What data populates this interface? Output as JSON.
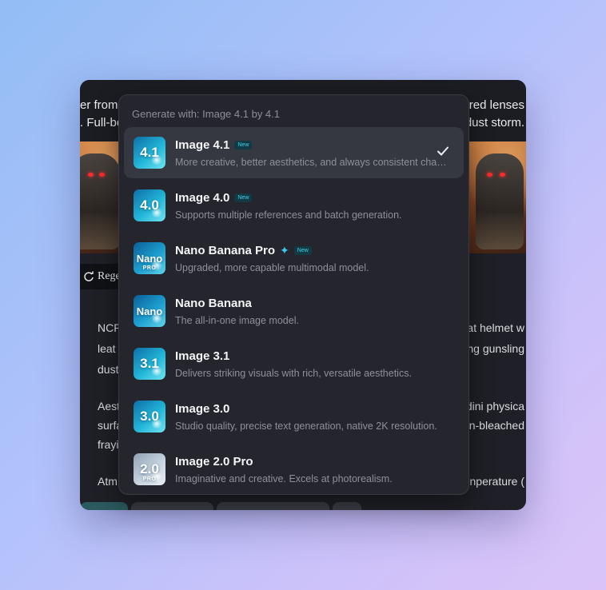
{
  "background_prompt": {
    "top_line_left": "er from",
    "top_line_right": "g red lenses",
    "second_line_left": ". Full-bo",
    "second_line_right": "dust storm.",
    "regen_label": "Regen",
    "lines": [
      {
        "left": "NCR",
        "right": "oat helmet w"
      },
      {
        "left": "leat",
        "right": "ing gunsling"
      },
      {
        "left": "dust",
        "right": ""
      },
      {
        "left": "Aest",
        "right": "dini physica"
      },
      {
        "left": "surfa",
        "right": "n-bleached"
      },
      {
        "left": "frayi",
        "right": ""
      },
      {
        "left": "Atm",
        "right": "nperature ("
      }
    ]
  },
  "dropdown": {
    "header": "Generate with: Image 4.1 by 4.1",
    "models": [
      {
        "name": "Image 4.1",
        "icon_label": "4.1",
        "badge": "New",
        "sparkle": false,
        "selected": true,
        "description": "More creative, better aesthetics, and always consistent characters."
      },
      {
        "name": "Image 4.0",
        "icon_label": "4.0",
        "badge": "New",
        "sparkle": false,
        "selected": false,
        "description": "Supports multiple references and batch generation."
      },
      {
        "name": "Nano Banana Pro",
        "icon_label": "Nano",
        "icon_sub": "PRO",
        "badge": "New",
        "sparkle": true,
        "selected": false,
        "description": "Upgraded, more capable multimodal model."
      },
      {
        "name": "Nano Banana",
        "icon_label": "Nano",
        "badge": "",
        "sparkle": false,
        "selected": false,
        "description": "The all-in-one image model."
      },
      {
        "name": "Image 3.1",
        "icon_label": "3.1",
        "badge": "",
        "sparkle": false,
        "selected": false,
        "description": "Delivers striking visuals with rich, versatile aesthetics."
      },
      {
        "name": "Image 3.0",
        "icon_label": "3.0",
        "badge": "",
        "sparkle": false,
        "selected": false,
        "description": "Studio quality, precise text generation, native 2K resolution."
      },
      {
        "name": "Image 2.0 Pro",
        "icon_label": "2.0",
        "icon_sub": "PRO",
        "badge": "",
        "sparkle": false,
        "selected": false,
        "description": "Imaginative and creative. Excels at photorealism."
      }
    ]
  },
  "colors": {
    "accent": "#3fd0e8",
    "panel": "#25262d",
    "selected_row": "#363841"
  },
  "icons": {
    "check": "check-icon",
    "sparkle": "sparkle-icon",
    "refresh": "refresh-icon"
  }
}
